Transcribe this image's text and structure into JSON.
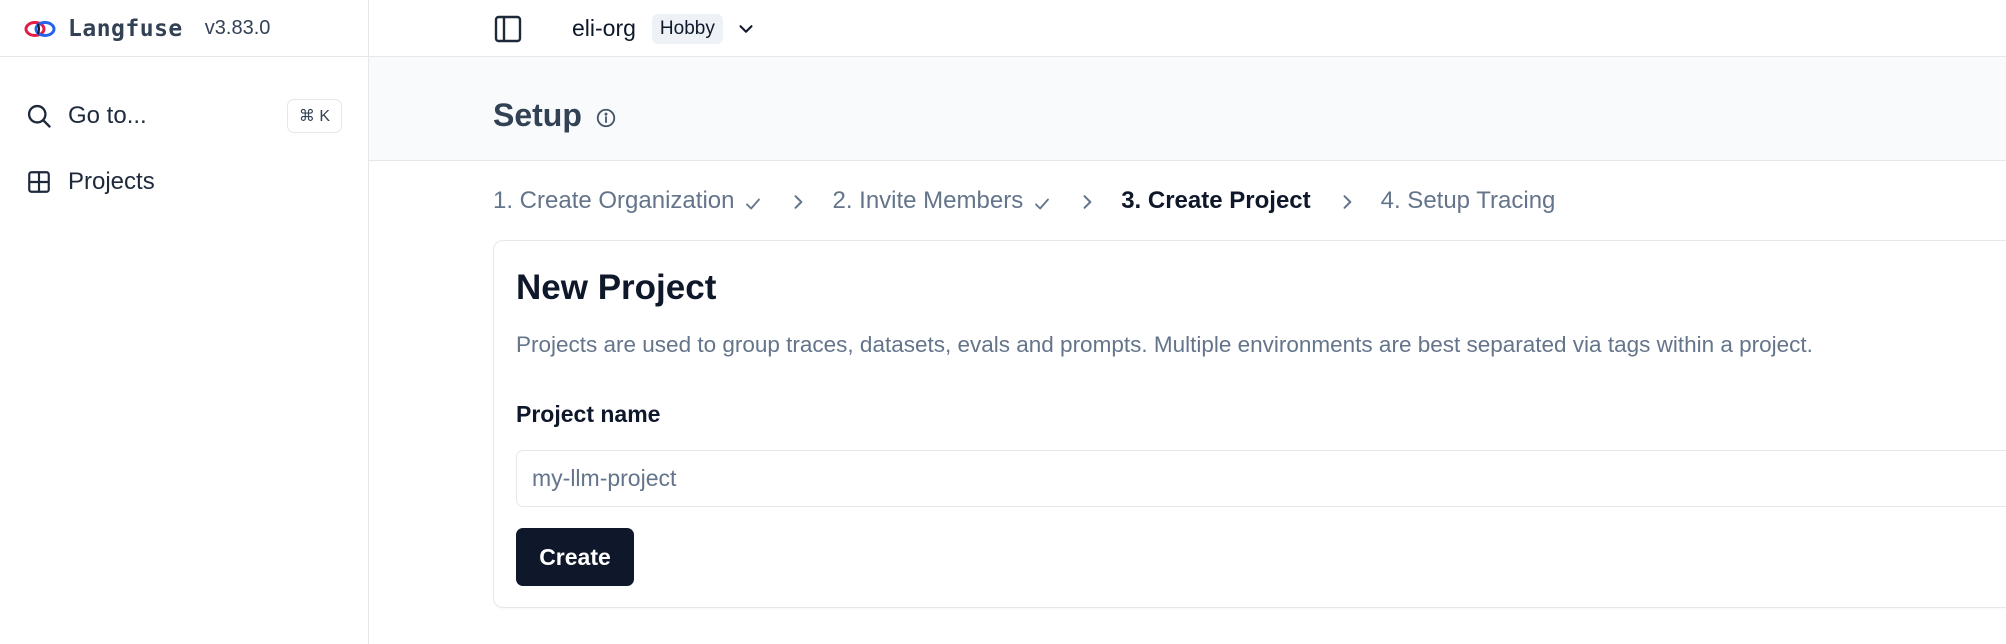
{
  "app": {
    "name": "Langfuse",
    "version": "v3.83.0",
    "logo_icon": "langfuse-logo-icon"
  },
  "sidebar": {
    "search": {
      "label": "Go to...",
      "shortcut": "⌘ K",
      "icon": "search-icon"
    },
    "items": [
      {
        "label": "Projects",
        "icon": "grid-icon"
      }
    ]
  },
  "topbar": {
    "toggle_icon": "sidebar-toggle-icon",
    "org_name": "eli-org",
    "plan": "Hobby",
    "dropdown_icon": "chevron-down-icon"
  },
  "header": {
    "title": "Setup",
    "info_icon": "info-icon"
  },
  "steps": [
    {
      "label": "1. Create Organization",
      "state": "complete"
    },
    {
      "label": "2. Invite Members",
      "state": "complete"
    },
    {
      "label": "3. Create Project",
      "state": "active"
    },
    {
      "label": "4. Setup Tracing",
      "state": "pending"
    }
  ],
  "card": {
    "title": "New Project",
    "description": "Projects are used to group traces, datasets, evals and prompts. Multiple environments are best separated via tags within a project.",
    "field_label": "Project name",
    "input_value": "",
    "input_placeholder": "my-llm-project",
    "submit_label": "Create"
  },
  "colors": {
    "primary": "#0f172a",
    "muted_text": "#64748b",
    "border": "#e5e7eb",
    "header_bg": "#f8fafc",
    "badge_bg": "#eef2f7"
  }
}
